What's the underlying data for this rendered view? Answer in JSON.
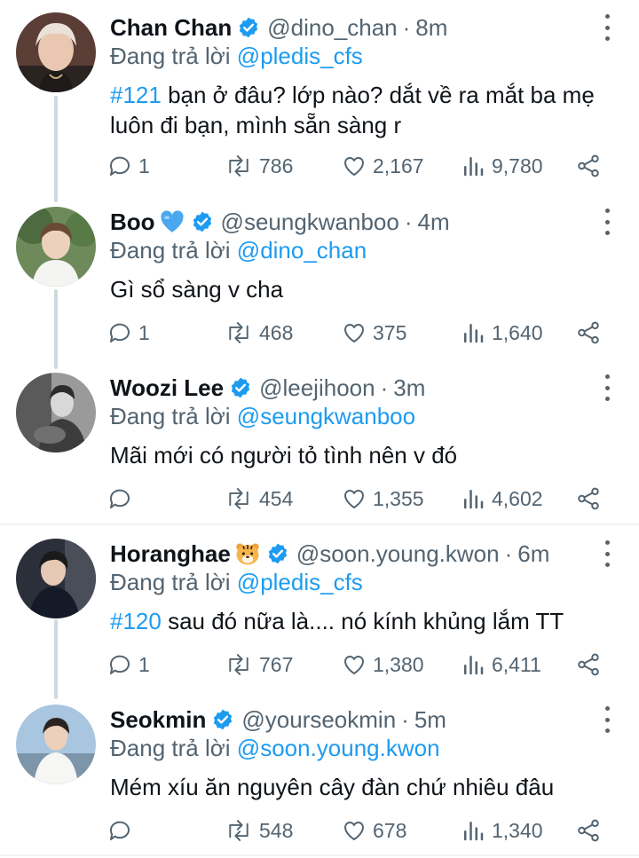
{
  "reply_prefix": "Đang trả lời",
  "colors": {
    "link": "#1d9bf0",
    "muted": "#536471",
    "verified": "#1d9bf0",
    "thread": "#cfd9de"
  },
  "tweets": [
    {
      "name": "Chan Chan",
      "emoji": "",
      "handle": "@dino_chan",
      "time": "8m",
      "replying_to": "@pledis_cfs",
      "hashtag": "#121",
      "text": " bạn ở đâu? lớp nào? dắt về ra mắt ba mẹ luôn đi bạn, mình sẵn sàng r",
      "replies": "1",
      "retweets": "786",
      "likes": "2,167",
      "views": "9,780"
    },
    {
      "name": "Boo",
      "emoji": "blue-heart",
      "handle": "@seungkwanboo",
      "time": "4m",
      "replying_to": "@dino_chan",
      "hashtag": "",
      "text": "Gì sổ sàng v cha",
      "replies": "1",
      "retweets": "468",
      "likes": "375",
      "views": "1,640"
    },
    {
      "name": "Woozi Lee",
      "emoji": "",
      "handle": "@leejihoon",
      "time": "3m",
      "replying_to": "@seungkwanboo",
      "hashtag": "",
      "text": "Mãi mới có người tỏ tình nên v đó",
      "replies": "",
      "retweets": "454",
      "likes": "1,355",
      "views": "4,602"
    },
    {
      "name": "Horanghae",
      "emoji": "tiger-face",
      "handle": "@soon.young.kwon",
      "time": "6m",
      "replying_to": "@pledis_cfs",
      "hashtag": "#120",
      "text": " sau đó nữa là.... nó kính khủng lắm TT",
      "replies": "1",
      "retweets": "767",
      "likes": "1,380",
      "views": "6,411"
    },
    {
      "name": "Seokmin",
      "emoji": "",
      "handle": "@yourseokmin",
      "time": "5m",
      "replying_to": "@soon.young.kwon",
      "hashtag": "",
      "text": "Mém xíu ăn nguyên cây đàn chứ nhiêu đâu",
      "replies": "",
      "retweets": "548",
      "likes": "678",
      "views": "1,340"
    }
  ]
}
